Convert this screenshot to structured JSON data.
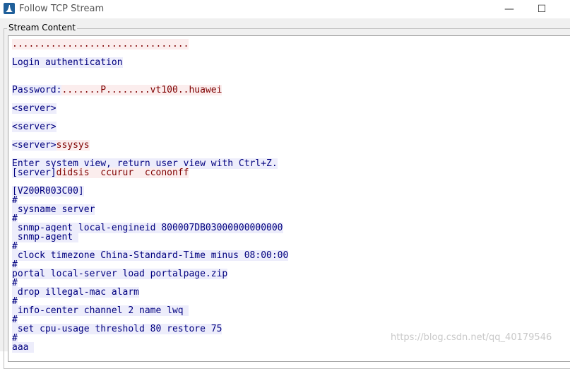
{
  "window": {
    "title": "Follow TCP Stream",
    "minimize_glyph": "—",
    "maximize_glyph": "☐"
  },
  "groupbox": {
    "label": "Stream Content"
  },
  "stream": {
    "lines": [
      {
        "text": "................................",
        "dir": "client"
      },
      {
        "text": "",
        "dir": "plain"
      },
      {
        "text": "Login authentication",
        "dir": "server"
      },
      {
        "text": "",
        "dir": "plain"
      },
      {
        "text": "",
        "dir": "plain"
      },
      {
        "text": "Password:",
        "dir": "server",
        "suffix": ".......P........vt100..huawei",
        "suffix_dir": "client"
      },
      {
        "text": "",
        "dir": "plain"
      },
      {
        "text": "<server>",
        "dir": "server"
      },
      {
        "text": "",
        "dir": "plain"
      },
      {
        "text": "<server>",
        "dir": "server"
      },
      {
        "text": "",
        "dir": "plain"
      },
      {
        "text": "<server>",
        "dir": "server",
        "suffix": "ssysys",
        "suffix_dir": "client"
      },
      {
        "text": "",
        "dir": "plain"
      },
      {
        "text": "Enter system view, return user view with Ctrl+Z.",
        "dir": "server"
      },
      {
        "text": "[server]",
        "dir": "server",
        "suffix": "didsis  ccurur  ccononff",
        "suffix_dir": "client"
      },
      {
        "text": "",
        "dir": "plain"
      },
      {
        "text": "[V200R003C00]",
        "dir": "server"
      },
      {
        "text": "#",
        "dir": "server"
      },
      {
        "text": " sysname server",
        "dir": "server"
      },
      {
        "text": "#",
        "dir": "server"
      },
      {
        "text": " snmp-agent local-engineid 800007DB03000000000000",
        "dir": "server"
      },
      {
        "text": " snmp-agent ",
        "dir": "server"
      },
      {
        "text": "#",
        "dir": "server"
      },
      {
        "text": " clock timezone China-Standard-Time minus 08:00:00",
        "dir": "server"
      },
      {
        "text": "#",
        "dir": "server"
      },
      {
        "text": "portal local-server load portalpage.zip",
        "dir": "server"
      },
      {
        "text": "#",
        "dir": "server"
      },
      {
        "text": " drop illegal-mac alarm",
        "dir": "server"
      },
      {
        "text": "#",
        "dir": "server"
      },
      {
        "text": " info-center channel 2 name lwq ",
        "dir": "server"
      },
      {
        "text": "#",
        "dir": "server"
      },
      {
        "text": " set cpu-usage threshold 80 restore 75",
        "dir": "server"
      },
      {
        "text": "#",
        "dir": "server"
      },
      {
        "text": "aaa ",
        "dir": "server"
      }
    ]
  },
  "watermark": "https://blog.csdn.net/qq_40179546",
  "colors": {
    "client_bg": "#fbeded",
    "client_fg": "#7f0000",
    "server_bg": "#ededfb",
    "server_fg": "#00007f"
  }
}
